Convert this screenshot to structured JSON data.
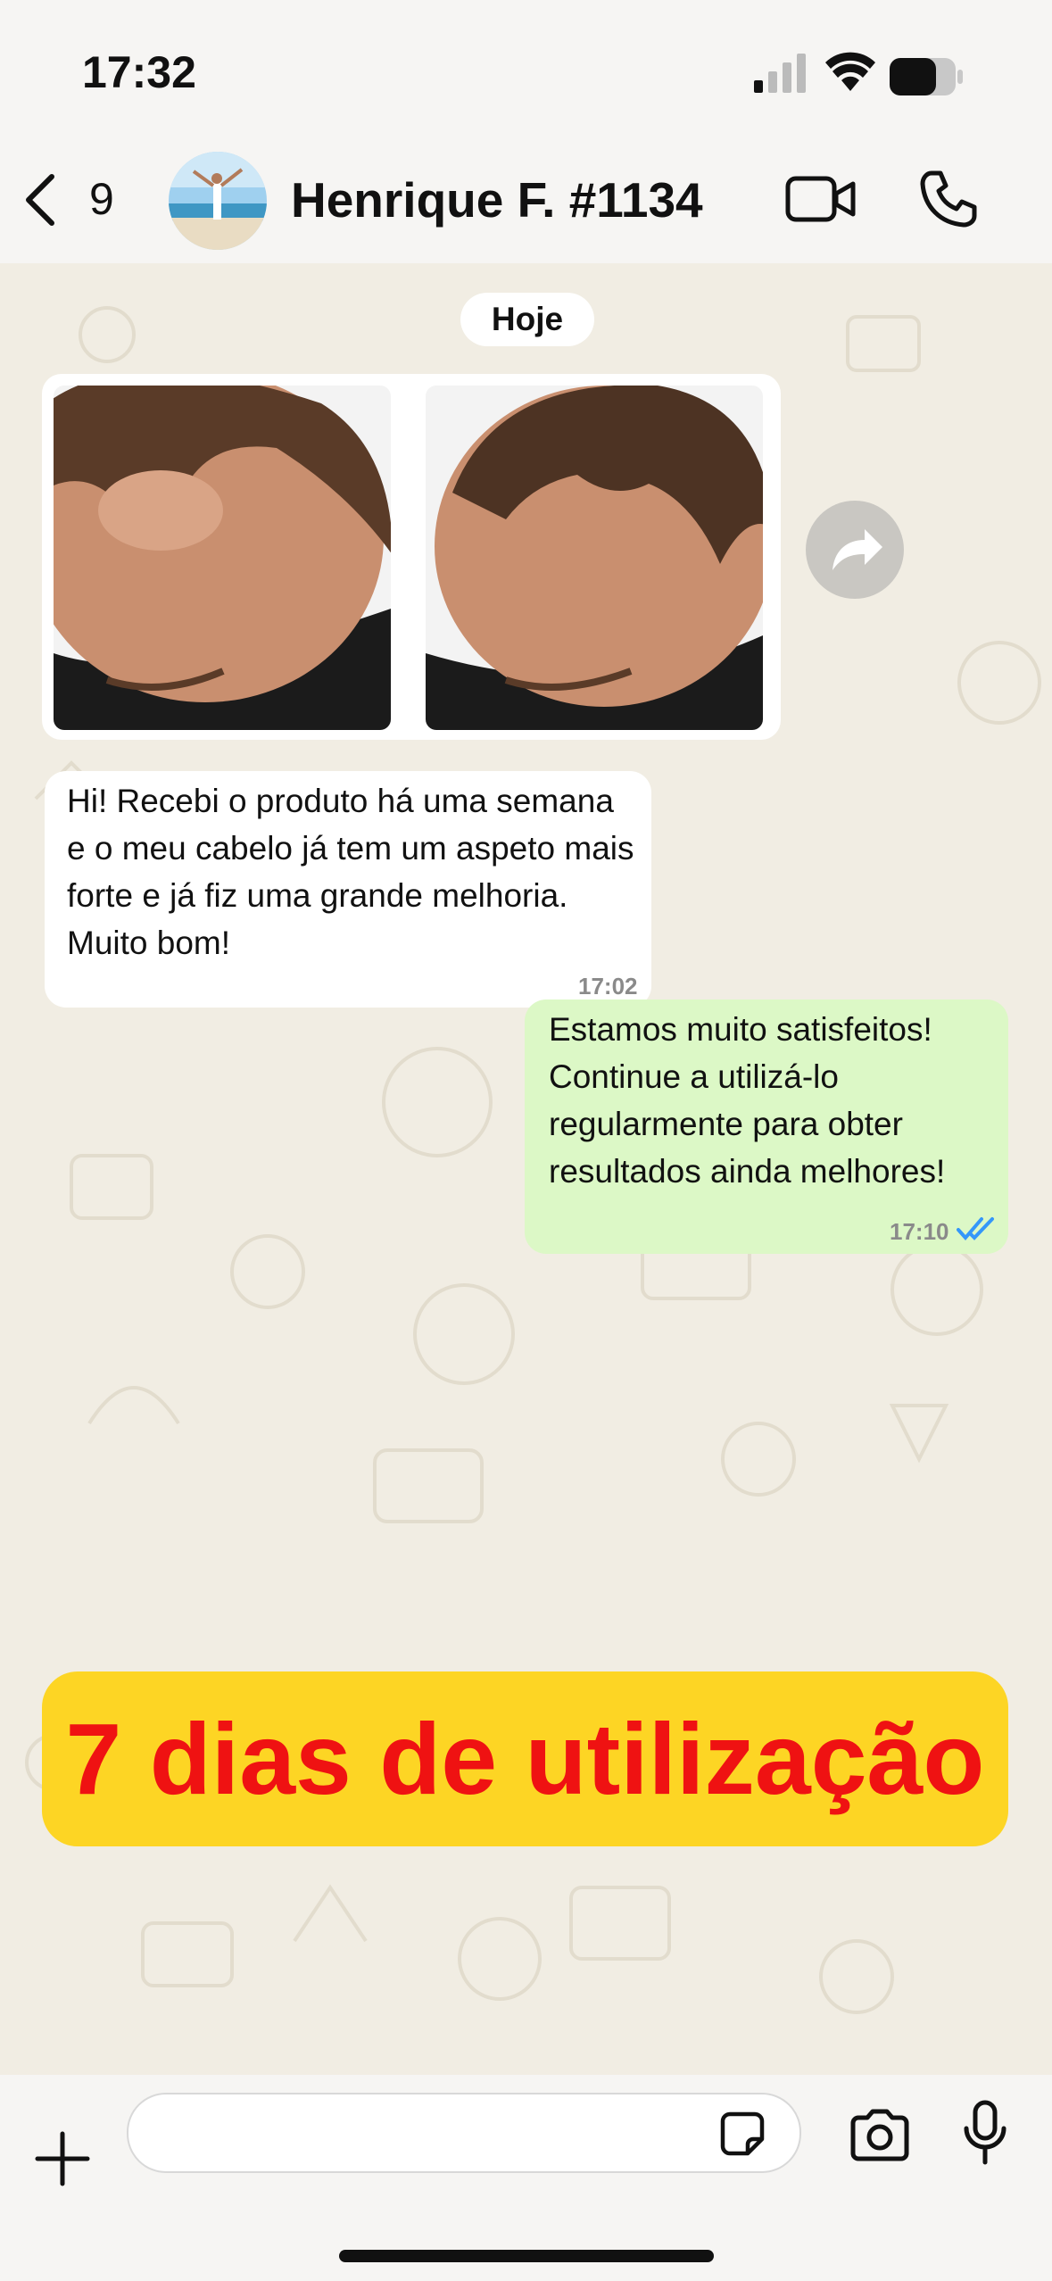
{
  "status_bar": {
    "time": "17:32"
  },
  "header": {
    "unread_count": "9",
    "contact_name": "Henrique F. #1134"
  },
  "chat": {
    "date_label": "Hoje",
    "messages": [
      {
        "direction": "incoming",
        "text": "Hi! Recebi o produto há uma semana e o meu cabelo já tem um aspeto mais forte e já fiz uma grande melhoria. Muito bom!",
        "time": "17:02"
      },
      {
        "direction": "outgoing",
        "text": "Estamos muito satisfeitos! Continue a utilizá-lo regularmente para obter resultados ainda melhores!",
        "time": "17:10",
        "status": "read"
      }
    ],
    "banner": "7 dias de utilização"
  },
  "icons": [
    "back-icon",
    "video-call-icon",
    "voice-call-icon",
    "forward-icon",
    "plus-icon",
    "sticker-icon",
    "camera-icon",
    "microphone-icon",
    "double-check-icon"
  ],
  "colors": {
    "outgoing_bubble": "#dcf8c6",
    "banner_bg": "#fdd524",
    "banner_text": "#ef1212",
    "read_ticks": "#3497f9"
  }
}
